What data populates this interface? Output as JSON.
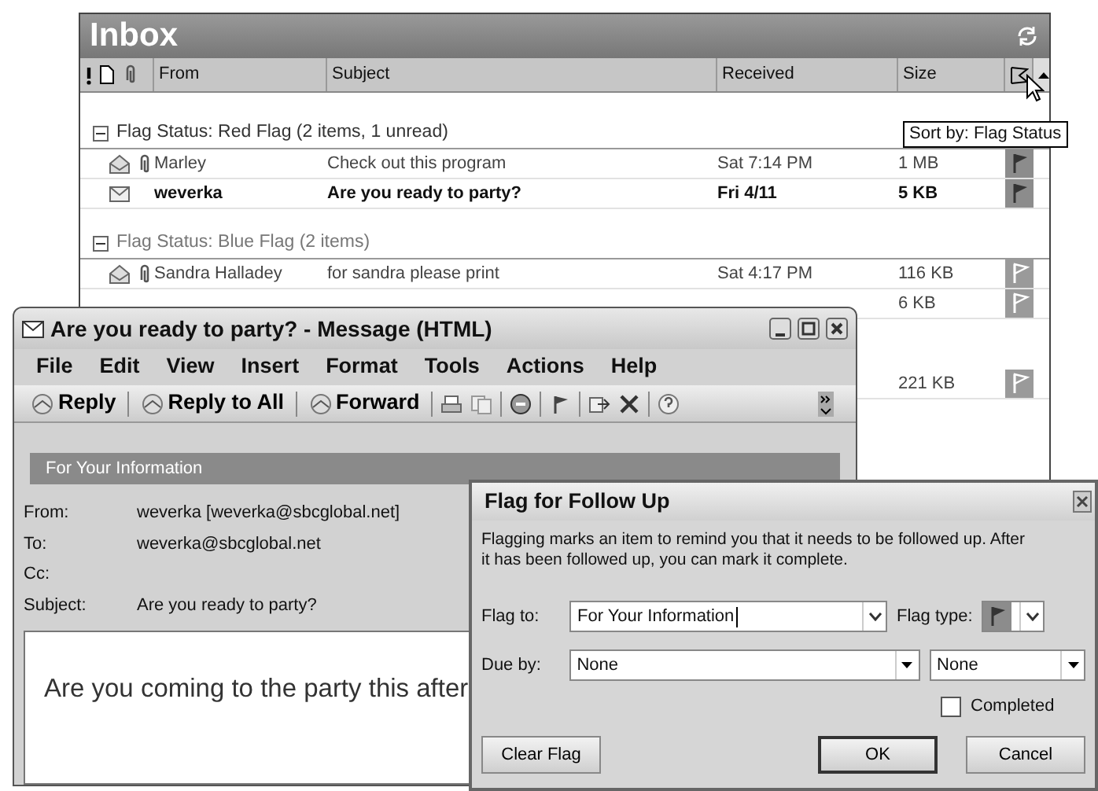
{
  "inbox": {
    "title": "Inbox",
    "columns": [
      "From",
      "Subject",
      "Received",
      "Size"
    ],
    "groups": [
      {
        "label": "Flag Status: Red Flag (2 items, 1 unread)",
        "expanded": true,
        "emphasis": true,
        "rows": [
          {
            "read": true,
            "attachment": true,
            "unread": false,
            "from": "Marley",
            "subject": "Check out this program",
            "received": "Sat 7:14 PM",
            "size": "1 MB",
            "kind": "red_flag"
          },
          {
            "read": false,
            "attachment": false,
            "unread": true,
            "from": "weverka",
            "subject": "Are you ready to party?",
            "received": "Fri 4/11",
            "size": "5 KB",
            "kind": "red_flag"
          }
        ]
      },
      {
        "label": "Flag Status: Blue Flag (2 items)",
        "expanded": true,
        "emphasis": false,
        "rows": [
          {
            "read": true,
            "attachment": true,
            "unread": false,
            "from": "Sandra Halladey",
            "subject": "for sandra please print",
            "received": "Sat 4:17 PM",
            "size": "116 KB",
            "kind": "blue_flag"
          },
          {
            "size": "6 KB",
            "kind": "blue_flag"
          }
        ]
      },
      {
        "rows": [
          {
            "size": "221 KB",
            "kind": "blue_flag"
          }
        ]
      }
    ],
    "tooltip": "Sort by: Flag Status"
  },
  "message": {
    "title": "Are you ready to party? - Message (HTML)",
    "menu": [
      "File",
      "Edit",
      "View",
      "Insert",
      "Format",
      "Tools",
      "Actions",
      "Help"
    ],
    "toolbar": [
      "Reply",
      "Reply to All",
      "Forward"
    ],
    "info_band": "For Your Information",
    "fields": [
      {
        "label": "From:",
        "value": "weverka [weverka@sbcglobal.net]"
      },
      {
        "label": "To:",
        "value": "weverka@sbcglobal.net"
      },
      {
        "label": "Cc:"
      },
      {
        "label": "Subject:",
        "value": "Are you ready to party?"
      }
    ],
    "body": "Are you coming to the party this after"
  },
  "dialog": {
    "title": "Flag for Follow Up",
    "description": "Flagging marks an item to remind you that it needs to be followed up.  After\nit has been followed up, you can mark it complete.",
    "flag_to": {
      "label": "Flag to:",
      "value": "For Your Information"
    },
    "flag_type": {
      "label": "Flag type:",
      "kind": "red_flag"
    },
    "due_by": {
      "label": "Due by:",
      "date": "None",
      "time": "None"
    },
    "completed": {
      "label": "Completed",
      "checked": false
    },
    "buttons": [
      {
        "label": "Clear Flag",
        "default": false
      },
      {
        "label": "OK",
        "default": true
      },
      {
        "label": "Cancel",
        "default": false
      }
    ]
  }
}
